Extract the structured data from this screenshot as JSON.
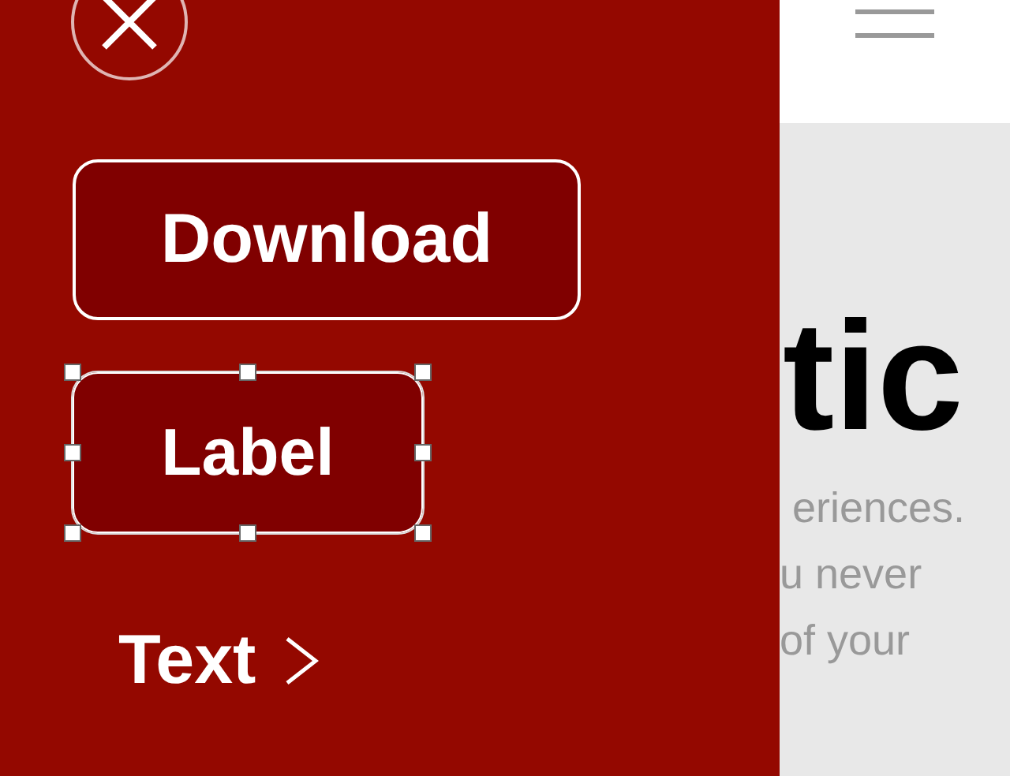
{
  "hero": {
    "headline_fragment": "tic",
    "paragraph_fragments": [
      "eriences.",
      "u never",
      "of your"
    ]
  },
  "menu": {
    "items": [
      {
        "kind": "button",
        "label": "Download",
        "selected": false
      },
      {
        "kind": "button",
        "label": "Label",
        "selected": true
      },
      {
        "kind": "link",
        "label": "Text"
      }
    ]
  }
}
